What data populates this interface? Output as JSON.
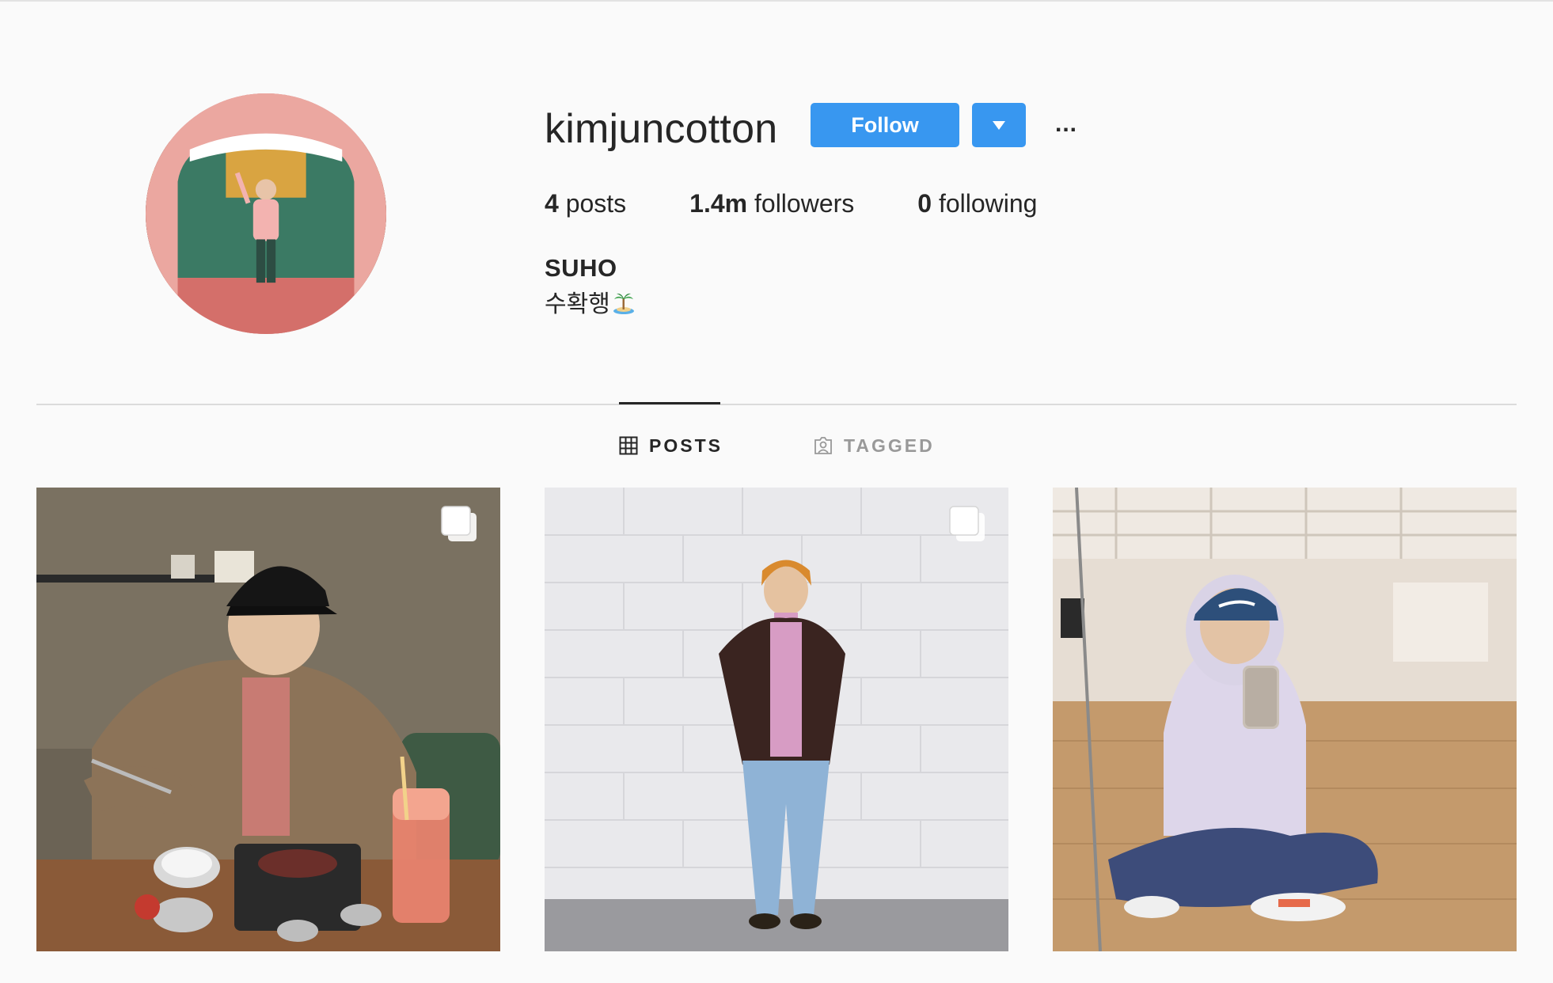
{
  "profile": {
    "username": "kimjuncotton",
    "full_name": "SUHO",
    "bio": "수확행"
  },
  "actions": {
    "follow_label": "Follow",
    "more_label": "..."
  },
  "stats": {
    "posts_count": "4",
    "posts_label": " posts",
    "followers_count": "1.4m",
    "followers_label": " followers",
    "following_count": "0",
    "following_label": " following"
  },
  "tabs": [
    {
      "label": "POSTS",
      "icon": "grid-icon",
      "active": true
    },
    {
      "label": "TAGGED",
      "icon": "tagged-user-icon",
      "active": false
    }
  ],
  "posts": [
    {
      "kind": "carousel",
      "icon": "multiple-images-icon",
      "description": "person eating at restaurant"
    },
    {
      "kind": "carousel",
      "icon": "multiple-images-icon",
      "description": "person standing against white wall"
    },
    {
      "kind": "single",
      "description": "mirror selfie in dance studio"
    }
  ],
  "colors": {
    "accent": "#3897f0",
    "text": "#262626",
    "muted": "#999999",
    "background": "#fafafa",
    "divider": "#dbdbdb"
  }
}
